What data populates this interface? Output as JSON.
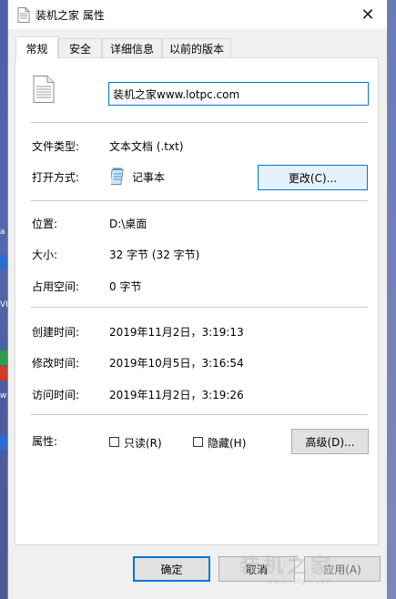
{
  "window": {
    "title": "装机之家 属性",
    "close_glyph": "✕"
  },
  "tabs": [
    {
      "label": "常规",
      "active": true
    },
    {
      "label": "安全",
      "active": false
    },
    {
      "label": "详细信息",
      "active": false
    },
    {
      "label": "以前的版本",
      "active": false
    }
  ],
  "general": {
    "file_name": "装机之家www.lotpc.com",
    "file_type_label": "文件类型:",
    "file_type_value": "文本文档 (.txt)",
    "open_with_label": "打开方式:",
    "open_with_value": "记事本",
    "change_button": "更改(C)...",
    "location_label": "位置:",
    "location_value": "D:\\桌面",
    "size_label": "大小:",
    "size_value": "32 字节 (32 字节)",
    "size_on_disk_label": "占用空间:",
    "size_on_disk_value": "0 字节",
    "created_label": "创建时间:",
    "created_value": "2019年11月2日，3:19:13",
    "modified_label": "修改时间:",
    "modified_value": "2019年10月5日，3:16:54",
    "accessed_label": "访问时间:",
    "accessed_value": "2019年11月2日，3:19:26",
    "attributes_label": "属性:",
    "readonly_label": "只读(R)",
    "readonly_checked": false,
    "hidden_label": "隐藏(H)",
    "hidden_checked": false,
    "advanced_button": "高级(D)..."
  },
  "footer": {
    "ok": "确定",
    "cancel": "取消",
    "apply": "应用(A)"
  },
  "watermark": {
    "text": "装机之家",
    "url": "www.lotpc.com"
  },
  "desktop_left": {
    "labels": [
      "a",
      "VI",
      "w"
    ]
  },
  "colors": {
    "accent": "#0078d7",
    "dialog_bg": "#f0f0f0",
    "panel_bg": "#ffffff"
  }
}
